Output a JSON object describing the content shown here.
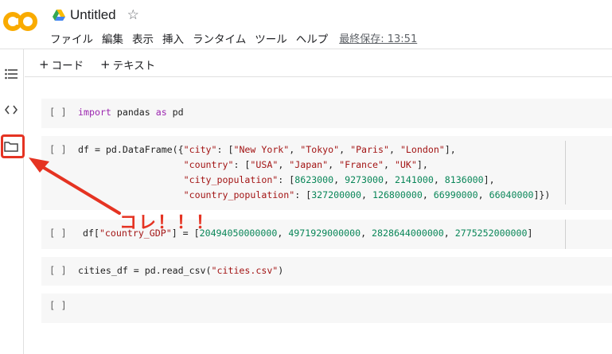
{
  "header": {
    "logo_text": "CO",
    "title": "Untitled",
    "menu": [
      "ファイル",
      "編集",
      "表示",
      "挿入",
      "ランタイム",
      "ツール",
      "ヘルプ"
    ],
    "last_saved": "最終保存: 13:51"
  },
  "toolbar": {
    "add_code": "コード",
    "add_text": "テキスト"
  },
  "cells": {
    "bracket": "[ ]"
  },
  "annotation": {
    "text": "コレ！！！"
  },
  "colors": {
    "accent_red": "#e53322",
    "logo_orange": "#f9ab00",
    "keyword": "#9c27b0",
    "string": "#a31515",
    "number": "#098658"
  }
}
